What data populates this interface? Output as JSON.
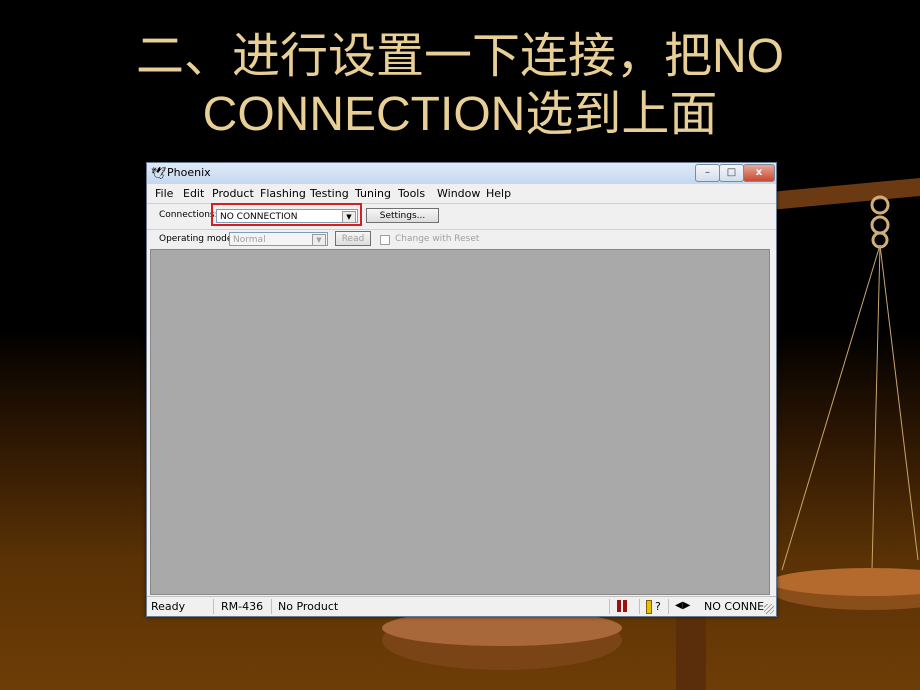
{
  "slide": {
    "title_line1": "二、进行设置一下连接，把NO",
    "title_line2": "CONNECTION选到上面"
  },
  "window": {
    "title": "Phoenix",
    "controls": {
      "minimize": "–",
      "maximize": "□",
      "close": "x"
    }
  },
  "menu": [
    "File",
    "Edit",
    "Product",
    "Flashing",
    "Testing",
    "Tuning",
    "Tools",
    "Window",
    "Help"
  ],
  "toolbar": {
    "connections_label": "Connections:",
    "connection_value": "NO CONNECTION",
    "settings_button": "Settings...",
    "operating_mode_label": "Operating mode:",
    "operating_mode_value": "Normal",
    "read_button": "Read",
    "change_with_reset_label": "Change with Reset"
  },
  "status_bar": {
    "state": "Ready",
    "model": "RM-436",
    "product": "No Product",
    "help_glyph": "?",
    "connection": "NO CONNE"
  },
  "colors": {
    "accent_highlight": "#d32020",
    "title_text": "#e8cf95",
    "workspace": "#a9a9a9"
  }
}
